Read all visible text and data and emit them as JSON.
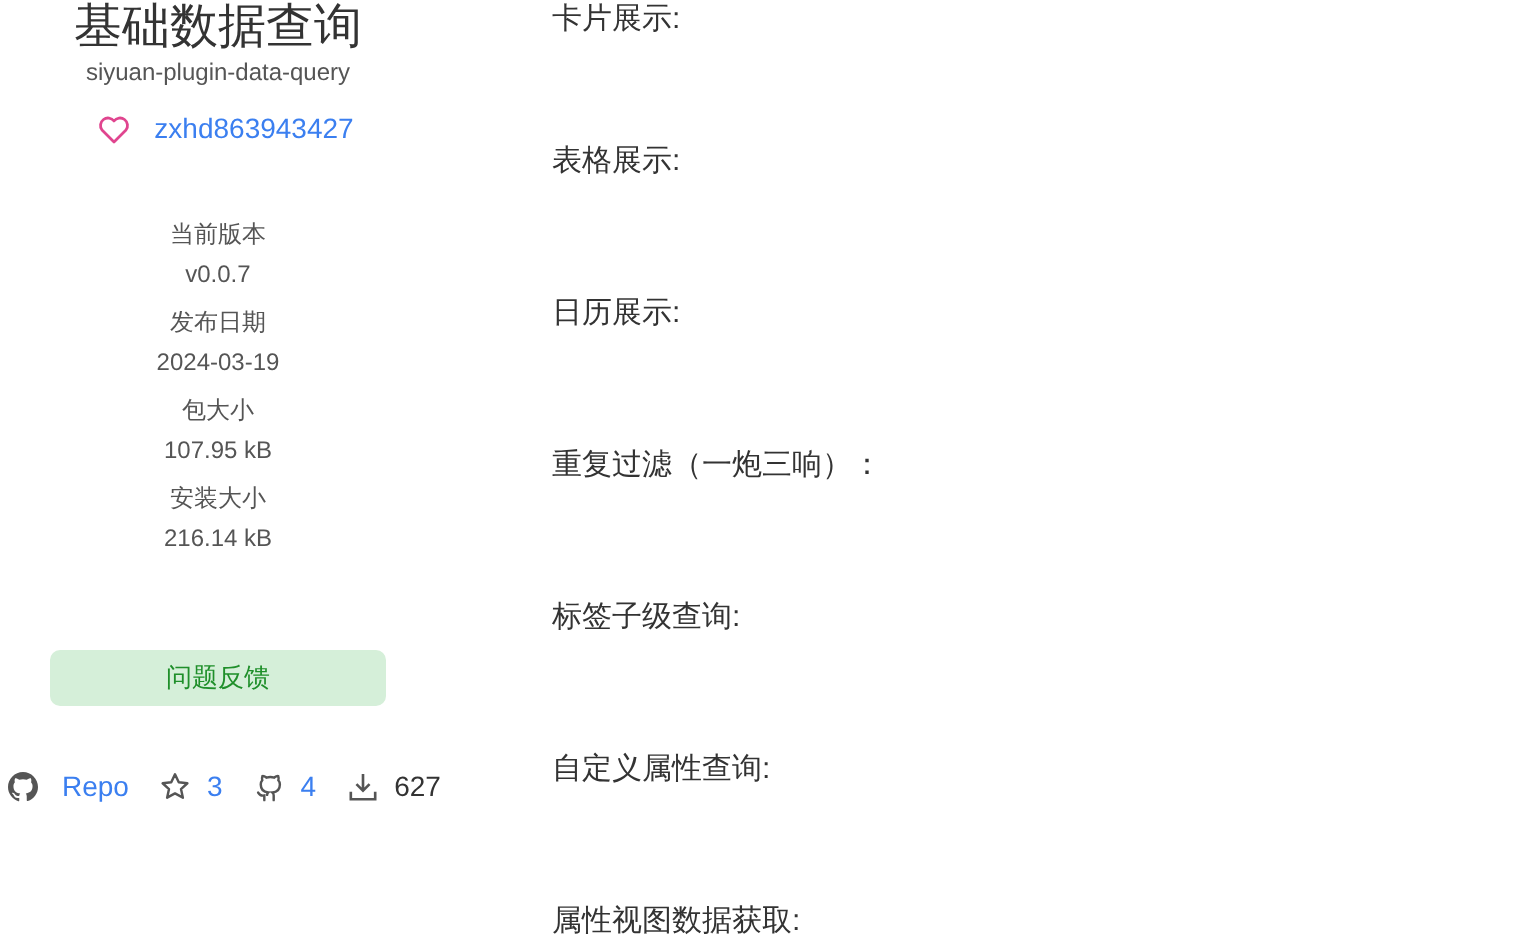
{
  "plugin": {
    "title": "基础数据查询",
    "package": "siyuan-plugin-data-query",
    "author": "zxhd863943427"
  },
  "stats": [
    {
      "label": "当前版本",
      "value": "v0.0.7"
    },
    {
      "label": "发布日期",
      "value": "2024-03-19"
    },
    {
      "label": "包大小",
      "value": "107.95 kB"
    },
    {
      "label": "安装大小",
      "value": "216.14 kB"
    }
  ],
  "feedback_button": "问题反馈",
  "links": {
    "repo": "Repo",
    "stars": "3",
    "forks": "4",
    "downloads": "627"
  },
  "headings": [
    "卡片展示:",
    "表格展示:",
    "日历展示:",
    "重复过滤（一炮三响）：",
    "标签子级查询:",
    "自定义属性查询:",
    "属性视图数据获取:"
  ]
}
